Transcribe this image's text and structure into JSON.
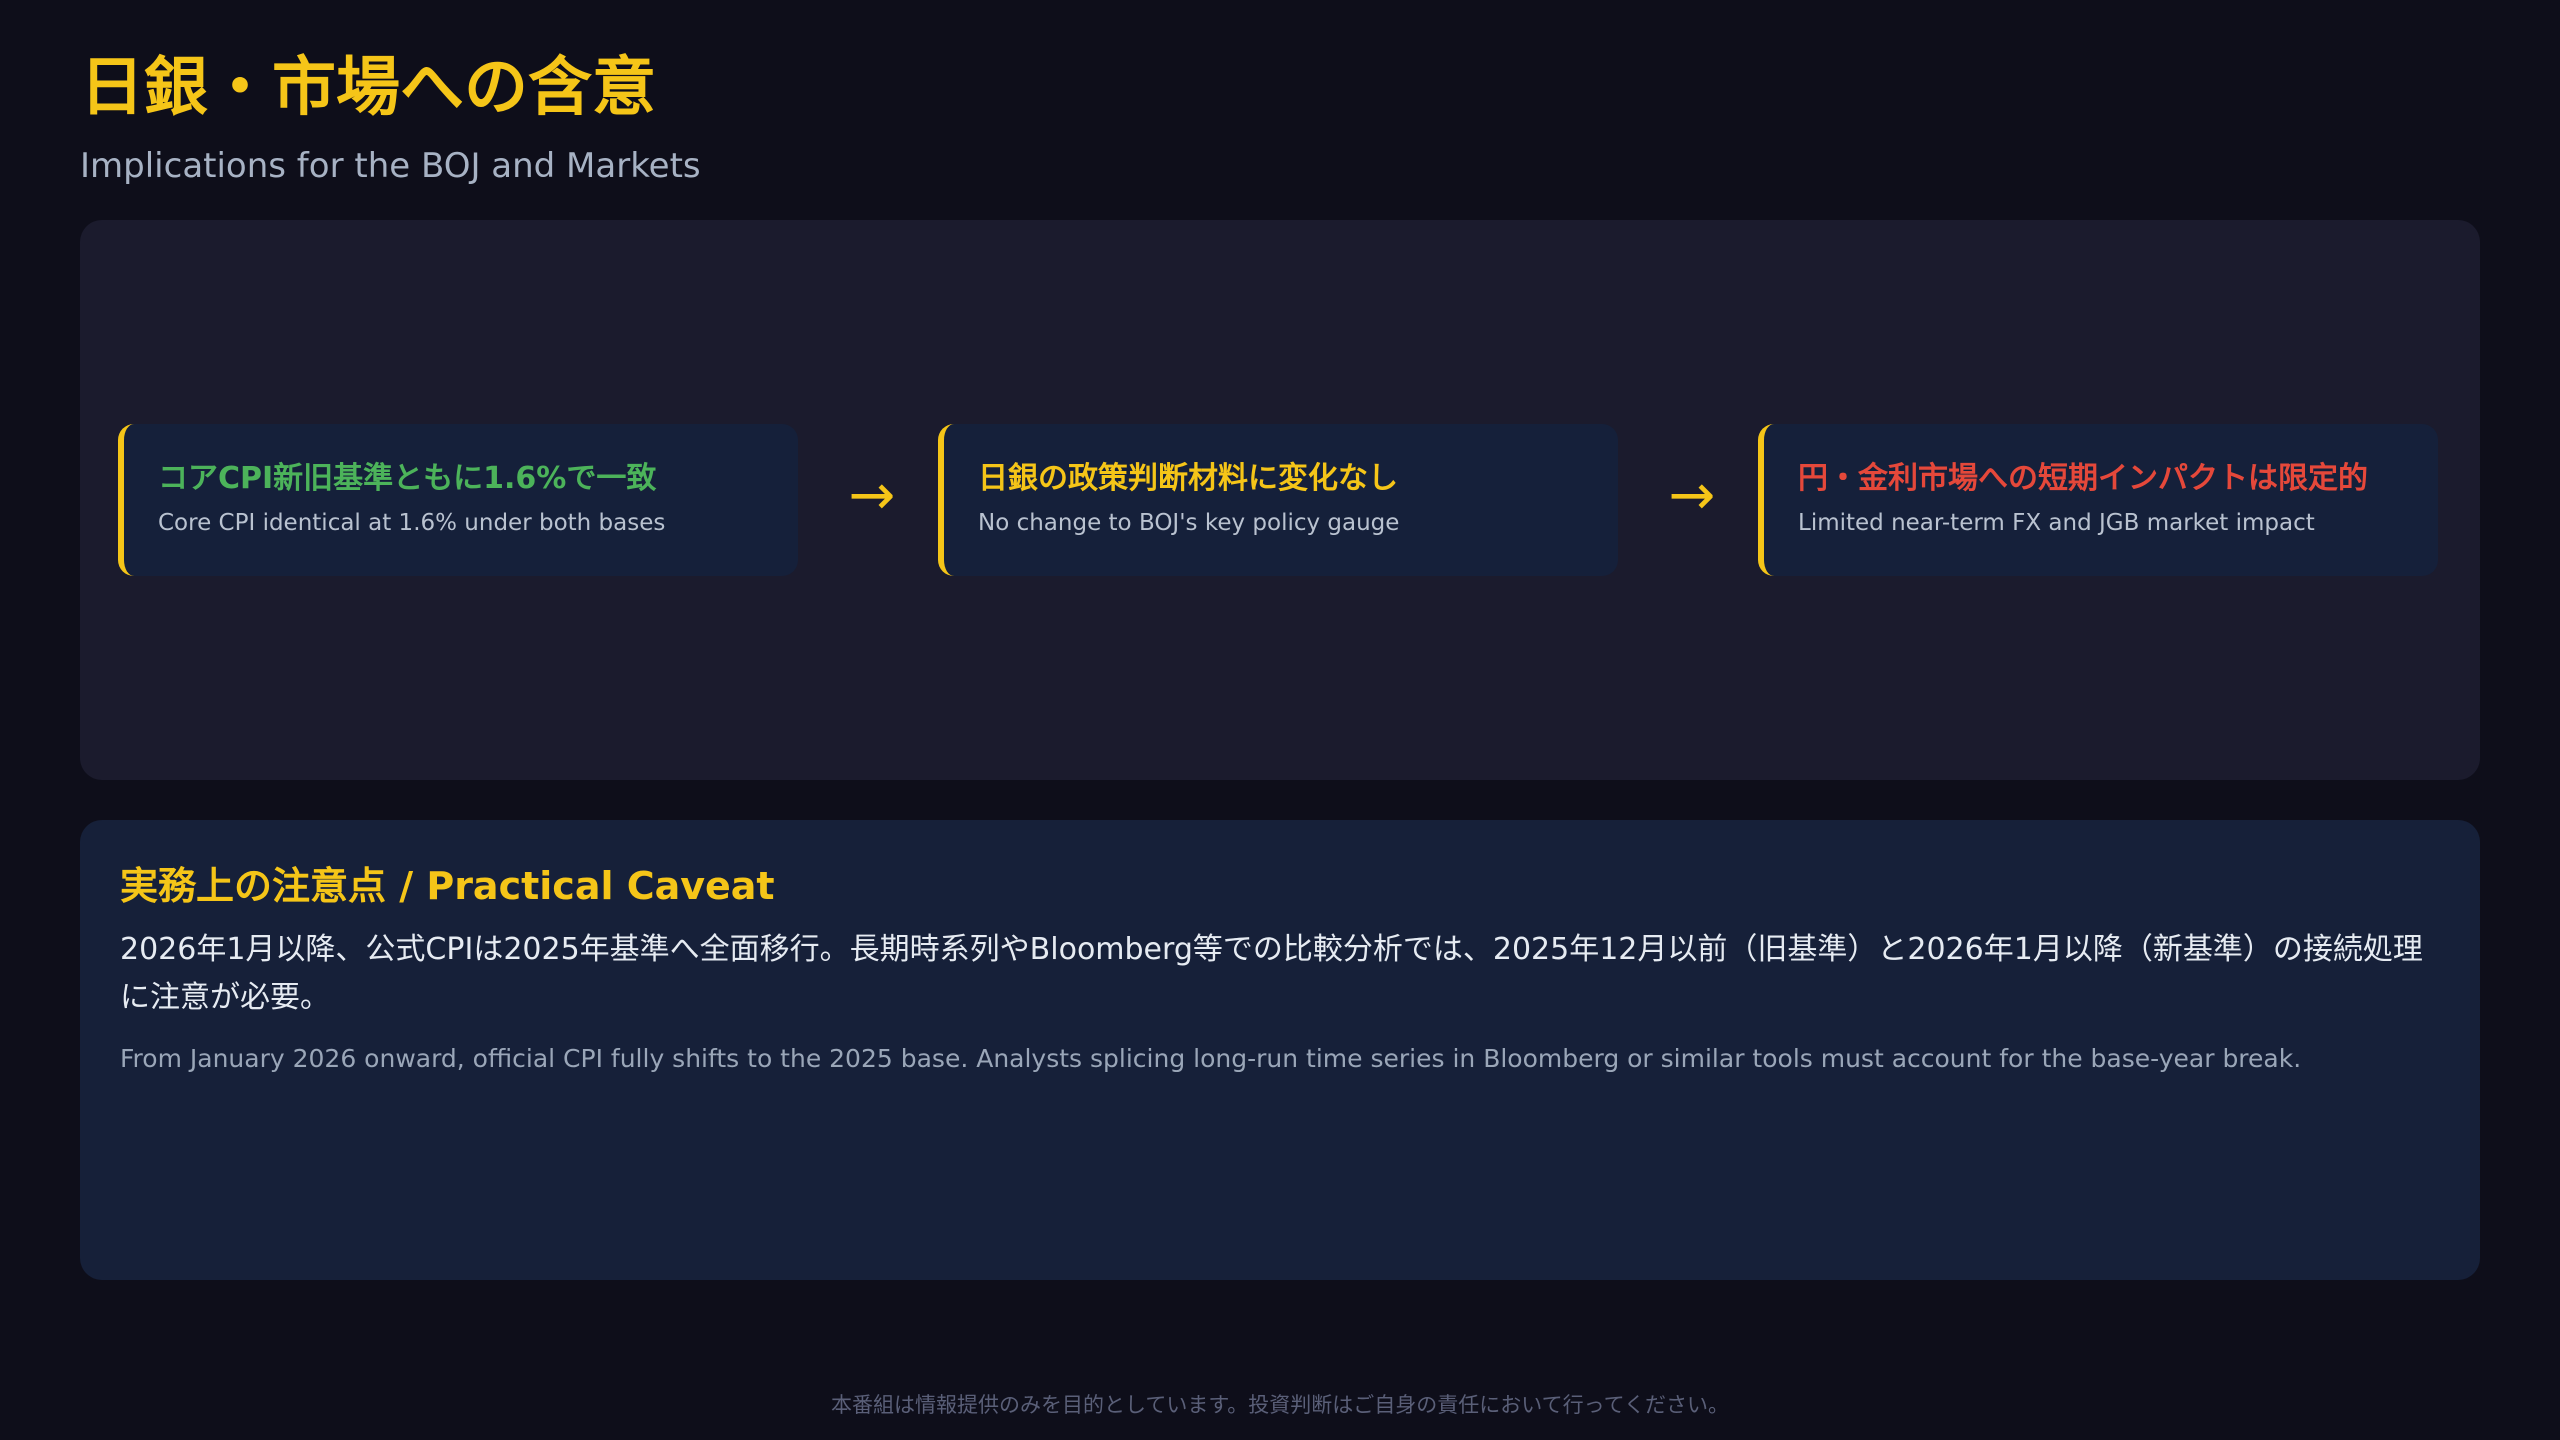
{
  "header": {
    "title": "日銀・市場への含意",
    "subtitle": "Implications for the BOJ and Markets"
  },
  "flow": {
    "steps": [
      {
        "title": "コアCPI新旧基準ともに1.6%で一致",
        "subtitle": "Core CPI identical at 1.6% under both bases",
        "title_color": "#4cb35a"
      },
      {
        "title": "日銀の政策判断材料に変化なし",
        "subtitle": "No change to BOJ's key policy gauge",
        "title_color": "#f5c518"
      },
      {
        "title": "円・金利市場への短期インパクトは限定的",
        "subtitle": "Limited near-term FX and JGB market impact",
        "title_color": "#e5483a"
      }
    ],
    "arrow_glyph": "→"
  },
  "caveat": {
    "title": "実務上の注意点 / Practical Caveat",
    "body_jp": "2026年1月以降、公式CPIは2025年基準へ全面移行。長期時系列やBloomberg等での比較分析では、2025年12月以前（旧基準）と2026年1月以降（新基準）の接続処理に注意が必要。",
    "body_en": "From January 2026 onward, official CPI fully shifts to the 2025 base. Analysts splicing long-run time series in Bloomberg or similar tools must account for the base-year break."
  },
  "footer": {
    "disclaimer": "本番組は情報提供のみを目的としています。投資判断はご自身の責任において行ってください。"
  },
  "colors": {
    "accent": "#f5c518",
    "background": "#0e0e1a",
    "panel": "#1b1b2d",
    "card": "#15203a"
  }
}
